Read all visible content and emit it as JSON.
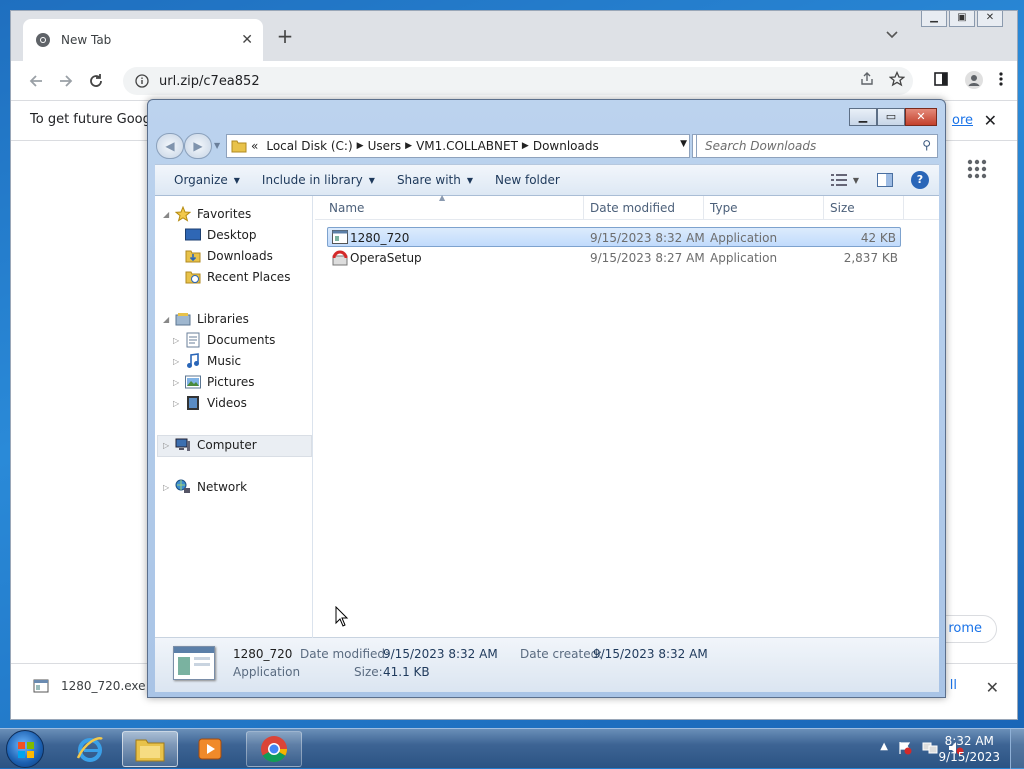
{
  "browser": {
    "tab_title": "New Tab",
    "tab_close": "✕",
    "new_tab": "+",
    "url": "url.zip/c7ea852",
    "infobar_text": "To get future Google",
    "infobar_link": "ore",
    "chrome_button": "rome",
    "download_file": "1280_720.exe",
    "download_all": "ll"
  },
  "explorer": {
    "breadcrumb": [
      "«",
      "Local Disk (C:)",
      "Users",
      "VM1.COLLABNET",
      "Downloads"
    ],
    "search_placeholder": "Search Downloads",
    "commands": [
      "Organize",
      "Include in library",
      "Share with",
      "New folder"
    ],
    "nav": {
      "favorites": "Favorites",
      "desktop": "Desktop",
      "downloads": "Downloads",
      "recent": "Recent Places",
      "libraries": "Libraries",
      "documents": "Documents",
      "music": "Music",
      "pictures": "Pictures",
      "videos": "Videos",
      "computer": "Computer",
      "network": "Network"
    },
    "columns": {
      "name": "Name",
      "date": "Date modified",
      "type": "Type",
      "size": "Size"
    },
    "files": [
      {
        "name": "1280_720",
        "date": "9/15/2023 8:32 AM",
        "type": "Application",
        "size": "42 KB"
      },
      {
        "name": "OperaSetup",
        "date": "9/15/2023 8:27 AM",
        "type": "Application",
        "size": "2,837 KB"
      }
    ],
    "details": {
      "name": "1280_720",
      "kind": "Application",
      "modified_label": "Date modified:",
      "modified_value": "9/15/2023 8:32 AM",
      "created_label": "Date created:",
      "created_value": "9/15/2023 8:32 AM",
      "size_label": "Size:",
      "size_value": "41.1 KB"
    }
  },
  "taskbar": {
    "time": "8:32 AM",
    "date": "9/15/2023"
  }
}
